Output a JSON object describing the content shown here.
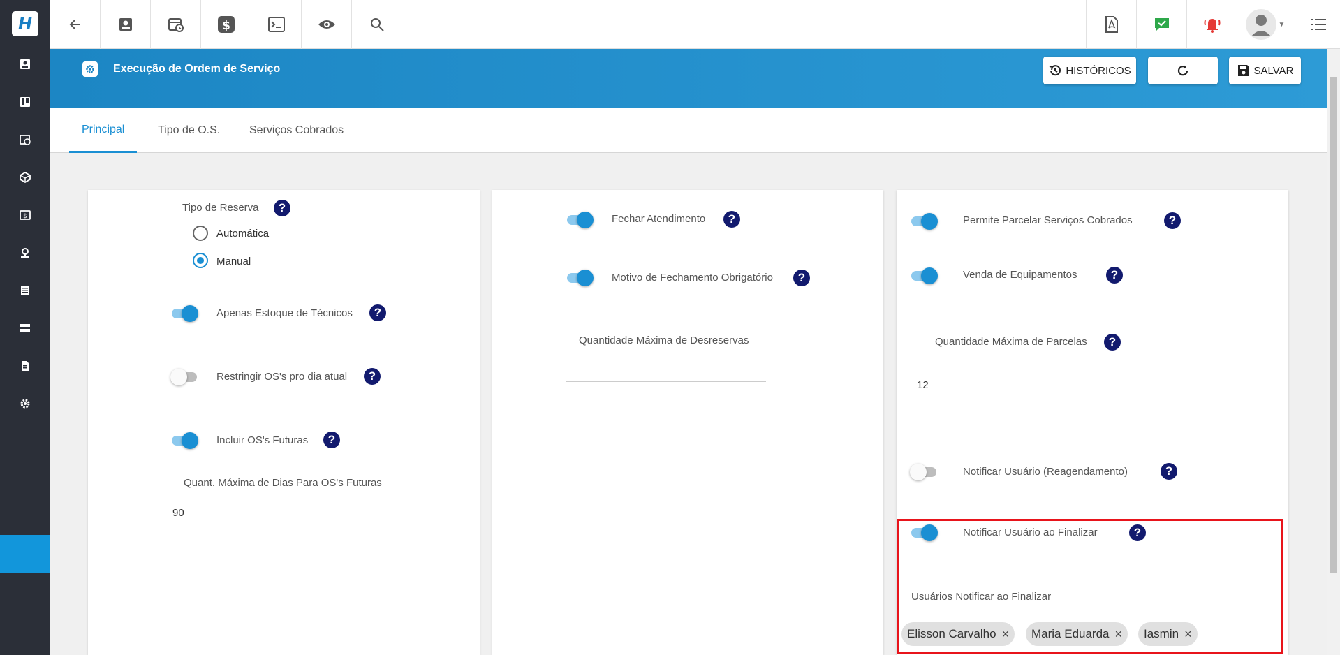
{
  "header": {
    "title": "Execução de Ordem de Serviço",
    "historicos_label": "HISTÓRICOS",
    "salvar_label": "SALVAR"
  },
  "tabs": [
    {
      "label": "Principal",
      "active": true
    },
    {
      "label": "Tipo de O.S.",
      "active": false
    },
    {
      "label": "Serviços Cobrados",
      "active": false
    }
  ],
  "col1": {
    "tipo_reserva_label": "Tipo de Reserva",
    "radio_automatica": "Automática",
    "radio_manual": "Manual",
    "selected": "Manual",
    "apenas_estoque": {
      "label": "Apenas Estoque de Técnicos",
      "on": true
    },
    "restringir": {
      "label": "Restringir OS's pro dia atual",
      "on": false
    },
    "incluir_futuras": {
      "label": "Incluir OS's Futuras",
      "on": true
    },
    "quant_max_dias_label": "Quant. Máxima de Dias Para OS's Futuras",
    "quant_max_dias_value": "90"
  },
  "col2": {
    "fechar_atendimento": {
      "label": "Fechar Atendimento",
      "on": true
    },
    "motivo_fechamento": {
      "label": "Motivo de Fechamento Obrigatório",
      "on": true
    },
    "quant_max_desreservas_label": "Quantidade Máxima de Desreservas",
    "quant_max_desreservas_value": ""
  },
  "col3": {
    "permite_parcelar": {
      "label": "Permite Parcelar Serviços Cobrados",
      "on": true
    },
    "venda_equipamentos": {
      "label": "Venda de Equipamentos",
      "on": true
    },
    "quant_max_parcelas_label": "Quantidade Máxima de Parcelas",
    "quant_max_parcelas_value": "12",
    "notificar_reagendamento": {
      "label": "Notificar Usuário (Reagendamento)",
      "on": false
    },
    "notificar_finalizar": {
      "label": "Notificar Usuário ao Finalizar",
      "on": true
    },
    "usuarios_notificar_label": "Usuários Notificar ao Finalizar",
    "chips": [
      "Elisson Carvalho",
      "Maria Eduarda",
      "Iasmin"
    ]
  },
  "help_glyph": "?",
  "chip_remove_glyph": "×",
  "colors": {
    "accent": "#1a8fd3",
    "sidebar": "#2b2f38",
    "help": "#121a6e",
    "highlight": "#e8141b"
  }
}
